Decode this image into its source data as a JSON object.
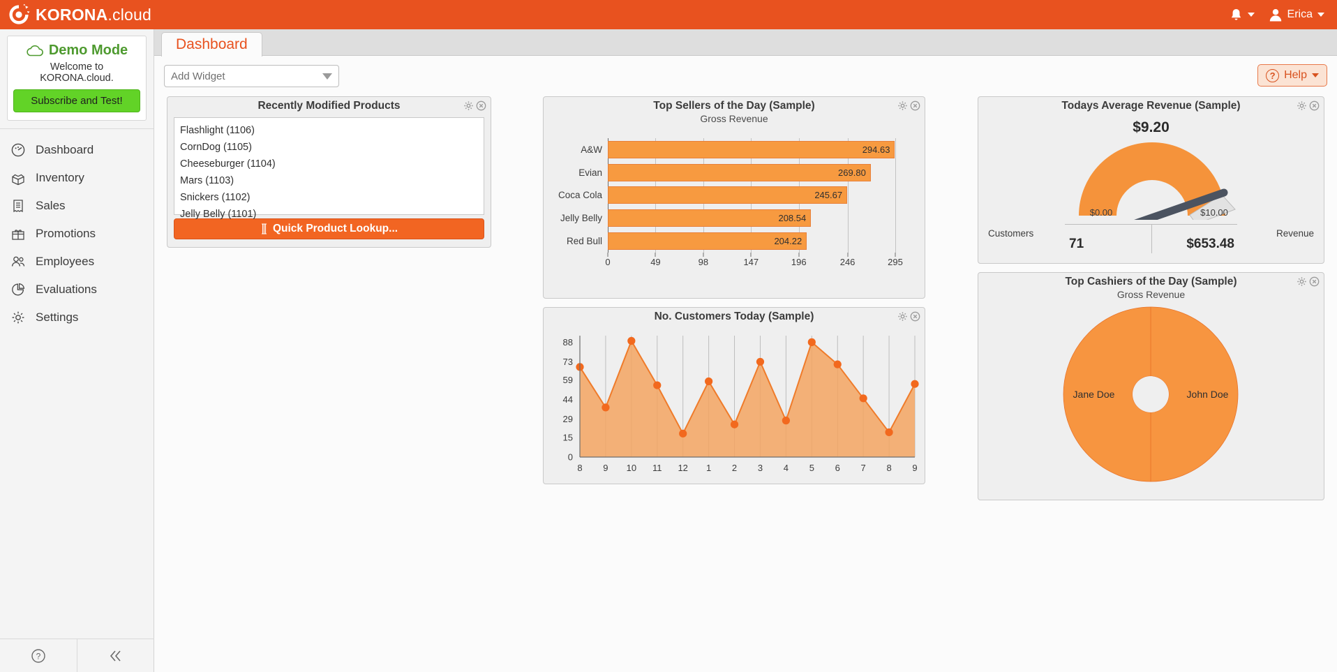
{
  "topbar": {
    "brand_bold": "KORONA",
    "brand_light": ".cloud",
    "notifications_icon": "bell-icon",
    "user_name": "Erica",
    "user_icon": "user-icon",
    "accent_color": "#e8521f"
  },
  "sidebar": {
    "demo": {
      "title": "Demo Mode",
      "subtitle": "Welcome to KORONA.cloud.",
      "button_label": "Subscribe and Test!",
      "cloud_icon": "cloud-icon",
      "button_color": "#62d327",
      "title_color": "#4e9a2f"
    },
    "items": [
      {
        "label": "Dashboard",
        "icon": "gauge-icon"
      },
      {
        "label": "Inventory",
        "icon": "open-box-icon"
      },
      {
        "label": "Sales",
        "icon": "receipt-icon"
      },
      {
        "label": "Promotions",
        "icon": "gift-icon"
      },
      {
        "label": "Employees",
        "icon": "people-icon"
      },
      {
        "label": "Evaluations",
        "icon": "pie-chart-icon"
      },
      {
        "label": "Settings",
        "icon": "gear-icon"
      }
    ],
    "footer": [
      {
        "icon": "help-circle-icon",
        "name": "help-button"
      },
      {
        "icon": "double-chevron-left-icon",
        "name": "collapse-sidebar-button"
      }
    ]
  },
  "toolbar": {
    "tab_label": "Dashboard",
    "add_widget_placeholder": "Add Widget",
    "help_label": "Help",
    "help_icon": "question-circle-icon"
  },
  "widgets": {
    "recent_products": {
      "title": "Recently Modified Products",
      "items": [
        "Flashlight (1106)",
        "CornDog (1105)",
        "Cheeseburger (1104)",
        "Mars (1103)",
        "Snickers (1102)",
        "Jelly Belly (1101)"
      ],
      "lookup_label": "Quick Product Lookup...",
      "lookup_icon": "barcode-scan-icon",
      "gear_icon": "gear-icon",
      "close_icon": "close-circle-icon"
    },
    "gauge": {
      "title": "Todays Average Revenue (Sample)",
      "value": "$9.20",
      "min_label": "$0.00",
      "max_label": "$10.00",
      "customers_label": "Customers",
      "customers_value": "71",
      "revenue_label": "Revenue",
      "revenue_value": "$653.48",
      "gear_icon": "gear-icon",
      "close_icon": "close-circle-icon"
    },
    "top_cashiers": {
      "title": "Top Cashiers of the Day (Sample)",
      "subtitle": "Gross Revenue",
      "gear_icon": "gear-icon",
      "close_icon": "close-circle-icon"
    },
    "top_sellers": {
      "gear_icon": "gear-icon",
      "close_icon": "close-circle-icon"
    },
    "customers_today": {
      "gear_icon": "gear-icon",
      "close_icon": "close-circle-icon"
    }
  },
  "chart_data": [
    {
      "id": "top_sellers",
      "type": "bar",
      "orientation": "horizontal",
      "title": "Top Sellers of the Day (Sample)",
      "subtitle": "Gross Revenue",
      "xlabel": "",
      "ylabel": "",
      "categories": [
        "A&W",
        "Evian",
        "Coca Cola",
        "Jelly Belly",
        "Red Bull"
      ],
      "values": [
        294.63,
        269.8,
        245.67,
        208.54,
        204.22
      ],
      "value_labels": [
        "294.63",
        "269.80",
        "245.67",
        "208.54",
        "204.22"
      ],
      "xticks": [
        0,
        49,
        98,
        147,
        196,
        246,
        295
      ],
      "xtick_labels": [
        "0",
        "49",
        "98",
        "147",
        "196",
        "246",
        "295"
      ],
      "xlim": [
        0,
        295
      ],
      "grid": true,
      "legend": "none",
      "bar_color": "#f79a40",
      "bar_border": "#e8803a"
    },
    {
      "id": "customers_today",
      "type": "area",
      "title": "No. Customers Today (Sample)",
      "subtitle": "",
      "xlabel": "",
      "ylabel": "",
      "categories": [
        "8",
        "9",
        "10",
        "11",
        "12",
        "1",
        "2",
        "3",
        "4",
        "5",
        "6",
        "7",
        "8",
        "9"
      ],
      "values": [
        69,
        38,
        89,
        55,
        18,
        58,
        25,
        73,
        28,
        88,
        71,
        45,
        19,
        56
      ],
      "yticks": [
        0,
        15,
        29,
        44,
        59,
        73,
        88
      ],
      "ytick_labels": [
        "0",
        "15",
        "29",
        "44",
        "59",
        "73",
        "88"
      ],
      "ylim": [
        0,
        93
      ],
      "grid": true,
      "legend": "none",
      "line_color": "#ef7b2a",
      "marker_color": "#f2691e",
      "fill_color": "#f3a462"
    },
    {
      "id": "top_cashiers",
      "type": "pie",
      "variant": "donut",
      "title": "Top Cashiers of the Day (Sample)",
      "subtitle": "Gross Revenue",
      "labels": [
        "John Doe",
        "Jane Doe"
      ],
      "values": [
        50,
        50
      ],
      "legend": "none",
      "slice_colors": [
        "#f79540",
        "#f79540"
      ]
    },
    {
      "id": "todays_average_revenue",
      "type": "gauge",
      "title": "Todays Average Revenue (Sample)",
      "value": 9.2,
      "value_label": "$9.20",
      "min": 0,
      "max": 10,
      "min_label": "$0.00",
      "max_label": "$10.00",
      "arc_color": "#f5933b",
      "needle_color": "#4b5360"
    }
  ]
}
